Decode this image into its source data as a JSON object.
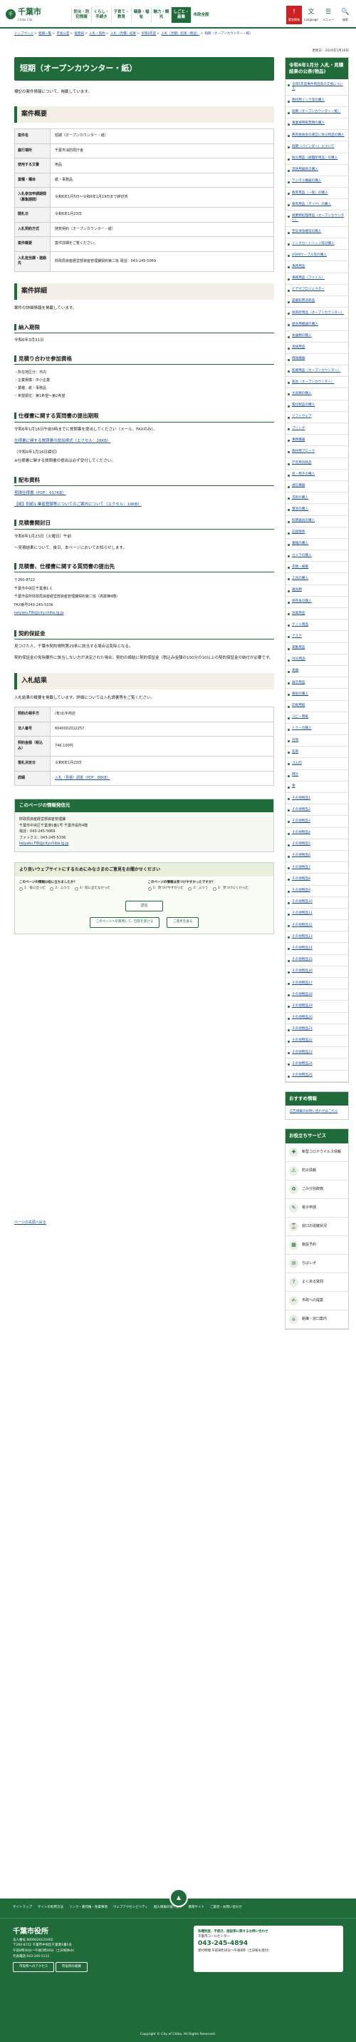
{
  "header": {
    "logo": "千葉市",
    "logo_sub": "Chiba City",
    "nav": [
      "防災・防犯情報",
      "くらし・手続き",
      "子育て・教育",
      "健康・福祉",
      "魅力・観光",
      "しごと・産業",
      "市政全般"
    ],
    "active_index": 5,
    "icons": [
      {
        "glyph": "文",
        "label": "Language"
      },
      {
        "glyph": "☰",
        "label": "メニュー"
      },
      {
        "glyph": "🔍",
        "label": "検索"
      }
    ],
    "emergency": {
      "glyph": "!",
      "label": "緊急情報"
    }
  },
  "breadcrumb": [
    "トップページ",
    "組織一覧",
    "市長公室",
    "総務局",
    "入札・契約",
    "入札（見積）結果",
    "令和6年度",
    "入札（見積）結果（物品）",
    "短期（オープンカウンター・紙）"
  ],
  "updated": "更新日：2024年5月16日",
  "page_title": "短期（オープンカウンター・紙）",
  "intro": "標記の案件情報について、掲載しています。",
  "sections": {
    "overview": "案件概要",
    "detail": "案件詳細",
    "result": "入札結果"
  },
  "overview_rows": [
    {
      "th": "案件名",
      "td": "短期（オープンカウンター・紙）"
    },
    {
      "th": "履行場所",
      "td": "千葉市消防局庁舎"
    },
    {
      "th": "使用する文書",
      "td": "用品"
    },
    {
      "th": "業種・種目",
      "td": "紙・事務品"
    },
    {
      "th": "入札参加申請期間（募集期間）",
      "td": "令和6年1月5日～令和6年1月19日まで締切済"
    },
    {
      "th": "開札日",
      "td": "令和6年1月23日"
    },
    {
      "th": "入札契約方式",
      "td": "随意契約（オープンカウンター・紙）"
    },
    {
      "th": "案件概要",
      "td": "案件詳細をご覧ください。"
    },
    {
      "th": "入札担当課・連絡先",
      "td": "財政局資産経営部資産管理課契約第二班 電話：043-245-5069"
    }
  ],
  "detail_intro": "案件の詳細情報を掲載しています。",
  "sub": {
    "delivery": "納入期限",
    "delivery_text": "令和6年3月31日",
    "qualification": "見積り合わせ参加資格",
    "qual_items": [
      "・所在地区分：市内",
      "・企業規模：中小企業",
      "・業種：紙・事務品",
      "・希望順位：第1希望～第2希望"
    ],
    "spec": "仕様書に関する質問書の提出期限",
    "spec_text": "令和6年1月16日午前0時までに質問書を提出してください（メール、FAXのみ）。",
    "spec_link": "仕様書に関する質問書の提出様式（エクセル：28KB）",
    "spec_note": "（令和6年1月16日締切）",
    "spec_note2": "※仕様書に関する質問書の提出は必ず受付してください。",
    "dist": "配布資料",
    "dist_links": [
      "見積仕様書（PDF：617KB）",
      "【紙】別紙1 業者登録等についてのご案内について（エクセル：19KB）"
    ],
    "open": "見積書開封日",
    "open_text": "令和6年1月23日（火曜日）午前",
    "open_note": "～見積結果について、後日、本ページにおいてお知らせします。",
    "submit": "見積書、仕様書に関する質問書の提出先",
    "submit_lines": [
      "〒260-8722",
      "千葉市中央区千葉港1-1",
      "千葉市役所財政局資産経営部資産管理課契約第二班（高層棟4階）",
      "FAX番号043-245-5336",
      "keiyaku.FIN@city.chiba.lg.jp"
    ],
    "deposit": "契約保証金",
    "deposit_text1": "見つけた人、千葉市契約規則第29条に該当する場合は免除となる。",
    "deposit_text2": "契約保証金の免除要件に該当しない方が決定された場合、契約の締結に契約保証金（税込み金額の100分の10以上の契約保証金の納付が必要です。"
  },
  "result_intro": "入札結果の概要を掲載しています。詳細については入札調書等をご覧ください。",
  "result_rows": [
    {
      "th": "契約の相手方",
      "td": "(有)北手商店"
    },
    {
      "th": "法人番号",
      "td": "6040002012257"
    },
    {
      "th": "契約金額（税込み）",
      "td": "746,100円"
    },
    {
      "th": "落札決定日",
      "td": "令和6年1月23日"
    },
    {
      "th": "詳細",
      "td": "入札（見積）調書（PDF：88KB）"
    }
  ],
  "contact": {
    "title": "このページの情報発信元",
    "lines": [
      "財政局資産経営部資産管理課",
      "千葉市中央区千葉港1番1号 千葉市役所4階",
      "電話：043-245-5069",
      "ファックス：043-245-5336",
      "keiyaku.FIN@city.chiba.lg.jp"
    ]
  },
  "survey": {
    "title": "より良いウェブサイトにするためにみなさまのご意見をお聞かせください",
    "q1": "このページの情報は役に立ちましたか？",
    "q1_opts": [
      "1：役に立った",
      "2：ふつう",
      "3：役に立たなかった"
    ],
    "q2": "このページの情報は見つけやすかったですか？",
    "q2_opts": [
      "1：見つけやすかった",
      "2：ふつう",
      "3：見つけにくかった"
    ],
    "submit": "送信",
    "btn_left": "このページへの質問して、回答を受ける",
    "btn_right": "ご意見を送る"
  },
  "pagetop": "ページの先頭へ戻る",
  "side": {
    "title": "令和6年1月分 入札・見積結果の公表(物品)",
    "items": [
      "令和5年度事件用品等の交換について",
      "教材用インク等の購入",
      "短期（オープンカウンター・紙）",
      "事業場用帳票類の購入",
      "教育委員会の運営に係る物品の購入",
      "短期（バインダー）について",
      "防災用品（避難所用品）の購入",
      "消防用器具の購入",
      "デジタル機器の購入",
      "教育用品（一般）の購入",
      "車両用品（タイヤ）の購入",
      "廃棄物処理用品（オープンカウンター）",
      "空気清浄機等の購入",
      "インクカートリッジ等の購入",
      "HDMIケーブル等の購入",
      "事務用品",
      "事務用品（ファイル）",
      "ビデオプロジェクター",
      "図書館用消耗品",
      "保育所用品（オープンカウンター）",
      "給食用機器の購入",
      "食器類の購入",
      "清掃用品",
      "情報機器",
      "医療用品（オープンカウンター）",
      "家具（オープンカウンター）",
      "文具類の購入",
      "電化製品の購入",
      "ソフトウェア",
      "プリンタ",
      "事務機器",
      "教材用ブロック",
      "庁舎用消耗品",
      "机・椅子の購入",
      "通信機器",
      "洗剤の購入",
      "電池の購入",
      "照明器具の購入",
      "記録媒体",
      "書籍の購入",
      "カメラの購入",
      "衣類・被服",
      "工具の購入",
      "寝具類",
      "保存食の購入",
      "消毒用品",
      "テント用品",
      "マスク",
      "運動用品",
      "AED用品",
      "楽器",
      "展示用品",
      "看板の購入",
      "印刷用紙",
      "コピー用紙",
      "トナーの購入",
      "封筒",
      "名刺",
      "ゴム印",
      "時計",
      "傘",
      "その他物品1",
      "その他物品2",
      "その他物品3",
      "その他物品4",
      "その他物品5",
      "その他物品6",
      "その他物品7",
      "その他物品8",
      "その他物品9",
      "その他物品10",
      "その他物品11",
      "その他物品12",
      "その他物品13",
      "その他物品14",
      "その他物品15",
      "その他物品16",
      "その他物品17",
      "その他物品18",
      "その他物品19",
      "その他物品20",
      "その他物品21",
      "その他物品22",
      "その他物品23",
      "その他物品24",
      "その他物品25"
    ]
  },
  "osusume": {
    "title": "おすすめ情報",
    "text": "広告掲載のお問い合わせはこちら"
  },
  "help": {
    "title": "お役立ちサービス",
    "items": [
      "新型コロナウイルス情報",
      "防災情報",
      "ごみ分別辞典",
      "電子申請",
      "窓口の混雑状況",
      "施設予約",
      "ちばレポ",
      "よくある質問",
      "市政への提案",
      "組織・窓口案内"
    ]
  },
  "footer": {
    "nav": [
      "サイトマップ",
      "サイトの利用方法",
      "リンク・著作権・免責事項",
      "ウェブアクセシビリティ",
      "個人情報の取り扱い",
      "携帯サイト",
      "ご意見・お問い合わせ"
    ],
    "name": "千葉市役所",
    "corp": "法人番号 8000020121002",
    "addr": [
      "〒260-8722 千葉市中央区千葉港1番1号",
      "午前8時30分～午後5時30分（土日祝休み）",
      "代表電話 043-245-5111"
    ],
    "btns": [
      "市役所へのアクセス",
      "市役所の組織"
    ],
    "call_title": "各種制度、手続き、施設等に関するお問い合わせ",
    "call_name": "千葉市コールセンター",
    "call_tel": "043-245-4894",
    "call_hours": "受付時間 午前8時30分～午後6時（土日祝も受付）",
    "copy": "Copyright © City of Chiba. All Rights Reserved."
  }
}
